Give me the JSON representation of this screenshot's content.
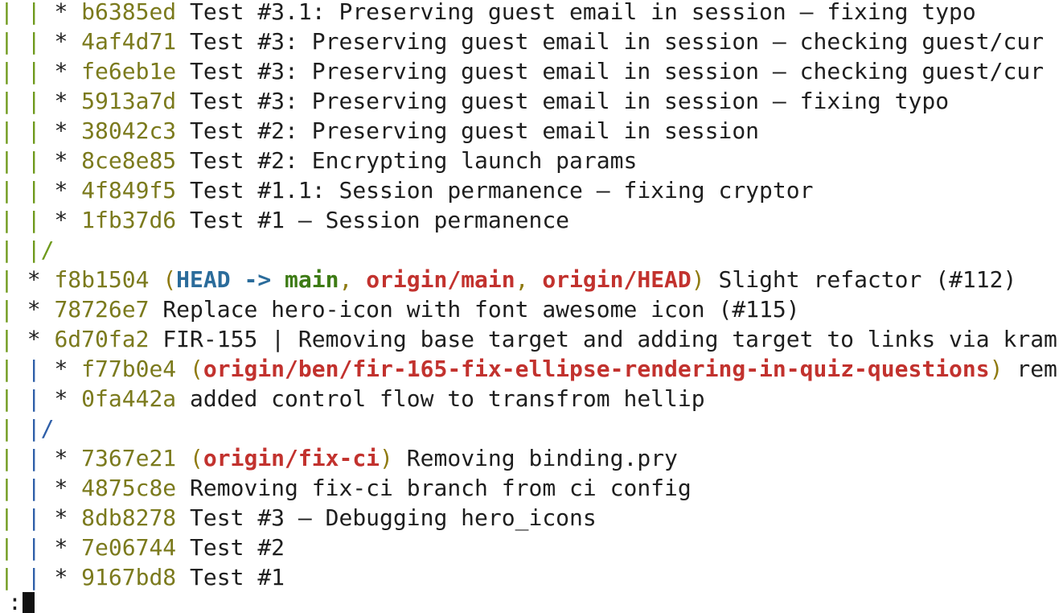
{
  "window": {
    "app": "git log --graph (pager)"
  },
  "pager": {
    "prompt": ":"
  },
  "colors": {
    "graph_lane_1": "#6f9a1c",
    "graph_lane_2": "#2f5fa8",
    "hash": "#7b7a1d",
    "ref_head": "#2b6c9b",
    "ref_local_branch": "#3d7b14",
    "ref_remote": "#c2322e"
  },
  "lines": [
    {
      "graph": [
        {
          "t": "| ",
          "c": "green"
        },
        {
          "t": "| ",
          "c": "green"
        },
        {
          "t": "* ",
          "c": "star"
        }
      ],
      "hash": "b6385ed",
      "refs": [],
      "message": "Test #3.1: Preserving guest email in session – fixing typo"
    },
    {
      "graph": [
        {
          "t": "| ",
          "c": "green"
        },
        {
          "t": "| ",
          "c": "green"
        },
        {
          "t": "* ",
          "c": "star"
        }
      ],
      "hash": "4af4d71",
      "refs": [],
      "message": "Test #3: Preserving guest email in session – checking guest/cur"
    },
    {
      "graph": [
        {
          "t": "| ",
          "c": "green"
        },
        {
          "t": "| ",
          "c": "green"
        },
        {
          "t": "* ",
          "c": "star"
        }
      ],
      "hash": "fe6eb1e",
      "refs": [],
      "message": "Test #3: Preserving guest email in session – checking guest/cur"
    },
    {
      "graph": [
        {
          "t": "| ",
          "c": "green"
        },
        {
          "t": "| ",
          "c": "green"
        },
        {
          "t": "* ",
          "c": "star"
        }
      ],
      "hash": "5913a7d",
      "refs": [],
      "message": "Test #3: Preserving guest email in session – fixing typo"
    },
    {
      "graph": [
        {
          "t": "| ",
          "c": "green"
        },
        {
          "t": "| ",
          "c": "green"
        },
        {
          "t": "* ",
          "c": "star"
        }
      ],
      "hash": "38042c3",
      "refs": [],
      "message": "Test #2: Preserving guest email in session"
    },
    {
      "graph": [
        {
          "t": "| ",
          "c": "green"
        },
        {
          "t": "| ",
          "c": "green"
        },
        {
          "t": "* ",
          "c": "star"
        }
      ],
      "hash": "8ce8e85",
      "refs": [],
      "message": "Test #2: Encrypting launch params"
    },
    {
      "graph": [
        {
          "t": "| ",
          "c": "green"
        },
        {
          "t": "| ",
          "c": "green"
        },
        {
          "t": "* ",
          "c": "star"
        }
      ],
      "hash": "4f849f5",
      "refs": [],
      "message": "Test #1.1: Session permanence – fixing cryptor"
    },
    {
      "graph": [
        {
          "t": "| ",
          "c": "green"
        },
        {
          "t": "| ",
          "c": "green"
        },
        {
          "t": "* ",
          "c": "star"
        }
      ],
      "hash": "1fb37d6",
      "refs": [],
      "message": "Test #1 – Session permanence"
    },
    {
      "graph": [
        {
          "t": "| ",
          "c": "green"
        },
        {
          "t": "|/",
          "c": "green"
        }
      ],
      "hash": "",
      "refs": [],
      "message": ""
    },
    {
      "graph": [
        {
          "t": "| ",
          "c": "green"
        },
        {
          "t": "* ",
          "c": "star"
        }
      ],
      "hash": "f8b1504",
      "refs": [
        {
          "t": "HEAD -> ",
          "c": "head"
        },
        {
          "t": "main",
          "c": "main"
        },
        {
          "t": ", ",
          "c": "paren"
        },
        {
          "t": "origin/main",
          "c": "origin"
        },
        {
          "t": ", ",
          "c": "paren"
        },
        {
          "t": "origin/HEAD",
          "c": "origin"
        }
      ],
      "message": "Slight refactor (#112)"
    },
    {
      "graph": [
        {
          "t": "| ",
          "c": "green"
        },
        {
          "t": "* ",
          "c": "star"
        }
      ],
      "hash": "78726e7",
      "refs": [],
      "message": "Replace hero-icon with font awesome icon (#115)"
    },
    {
      "graph": [
        {
          "t": "| ",
          "c": "green"
        },
        {
          "t": "* ",
          "c": "star"
        }
      ],
      "hash": "6d70fa2",
      "refs": [],
      "message": "FIR-155 | Removing base target and adding target to links via kram"
    },
    {
      "graph": [
        {
          "t": "| ",
          "c": "green"
        },
        {
          "t": "| ",
          "c": "blue"
        },
        {
          "t": "* ",
          "c": "star"
        }
      ],
      "hash": "f77b0e4",
      "refs": [
        {
          "t": "origin/ben/fir-165-fix-ellipse-rendering-in-quiz-questions",
          "c": "origin"
        }
      ],
      "message": "rem"
    },
    {
      "graph": [
        {
          "t": "| ",
          "c": "green"
        },
        {
          "t": "| ",
          "c": "blue"
        },
        {
          "t": "* ",
          "c": "star"
        }
      ],
      "hash": "0fa442a",
      "refs": [],
      "message": "added control flow to transfrom hellip"
    },
    {
      "graph": [
        {
          "t": "| ",
          "c": "green"
        },
        {
          "t": "|/",
          "c": "blue"
        }
      ],
      "hash": "",
      "refs": [],
      "message": ""
    },
    {
      "graph": [
        {
          "t": "| ",
          "c": "green"
        },
        {
          "t": "| ",
          "c": "blue"
        },
        {
          "t": "* ",
          "c": "star"
        }
      ],
      "hash": "7367e21",
      "refs": [
        {
          "t": "origin/fix-ci",
          "c": "origin"
        }
      ],
      "message": "Removing binding.pry"
    },
    {
      "graph": [
        {
          "t": "| ",
          "c": "green"
        },
        {
          "t": "| ",
          "c": "blue"
        },
        {
          "t": "* ",
          "c": "star"
        }
      ],
      "hash": "4875c8e",
      "refs": [],
      "message": "Removing fix-ci branch from ci config"
    },
    {
      "graph": [
        {
          "t": "| ",
          "c": "green"
        },
        {
          "t": "| ",
          "c": "blue"
        },
        {
          "t": "* ",
          "c": "star"
        }
      ],
      "hash": "8db8278",
      "refs": [],
      "message": "Test #3 – Debugging hero_icons"
    },
    {
      "graph": [
        {
          "t": "| ",
          "c": "green"
        },
        {
          "t": "| ",
          "c": "blue"
        },
        {
          "t": "* ",
          "c": "star"
        }
      ],
      "hash": "7e06744",
      "refs": [],
      "message": "Test #2"
    },
    {
      "graph": [
        {
          "t": "| ",
          "c": "green"
        },
        {
          "t": "| ",
          "c": "blue"
        },
        {
          "t": "* ",
          "c": "star"
        }
      ],
      "hash": "9167bd8",
      "refs": [],
      "message": "Test #1"
    }
  ]
}
